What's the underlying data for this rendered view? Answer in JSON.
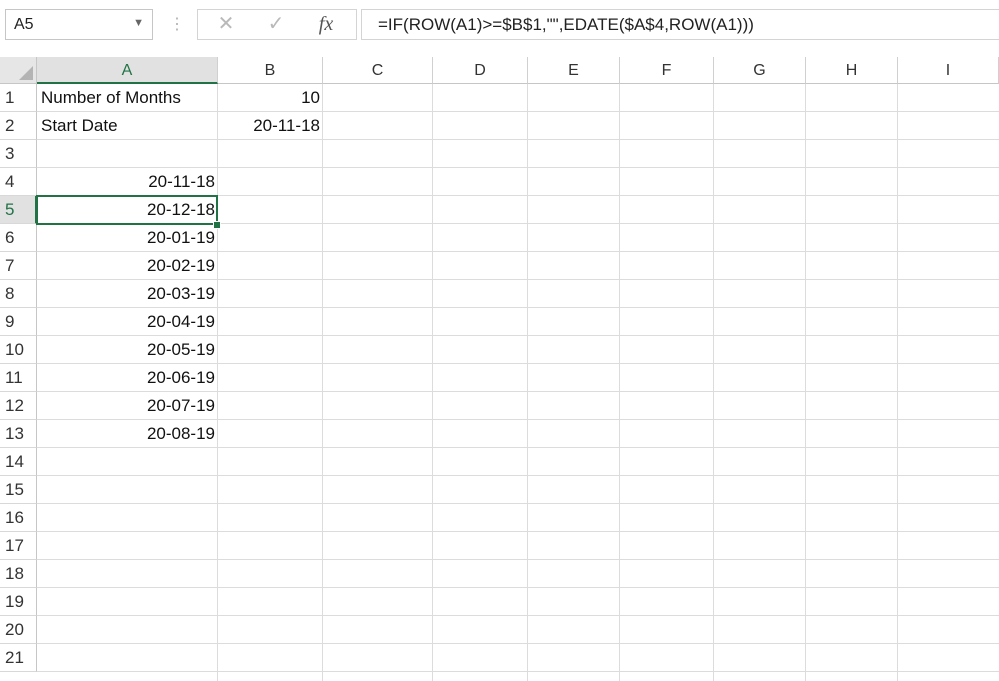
{
  "formula_bar": {
    "name_box": "A5",
    "cancel_icon": "x-icon",
    "enter_icon": "check-icon",
    "fx_label": "fx",
    "formula": "=IF(ROW(A1)>=$B$1,\"\",EDATE($A$4,ROW(A1)))"
  },
  "sheet": {
    "selected_cell": "A5",
    "accent_color": "#217346",
    "columns": [
      "A",
      "B",
      "C",
      "D",
      "E",
      "F",
      "G",
      "H",
      "I"
    ],
    "rows": [
      "1",
      "2",
      "3",
      "4",
      "5",
      "6",
      "7",
      "8",
      "9",
      "10",
      "11",
      "12",
      "13",
      "14",
      "15",
      "16",
      "17",
      "18",
      "19",
      "20",
      "21"
    ],
    "cells": {
      "A1": "Number of Months",
      "B1": "10",
      "A2": "Start Date",
      "B2": "20-11-18",
      "A4": "20-11-18",
      "A5": "20-12-18",
      "A6": "20-01-19",
      "A7": "20-02-19",
      "A8": "20-03-19",
      "A9": "20-04-19",
      "A10": "20-05-19",
      "A11": "20-06-19",
      "A12": "20-07-19",
      "A13": "20-08-19"
    }
  }
}
